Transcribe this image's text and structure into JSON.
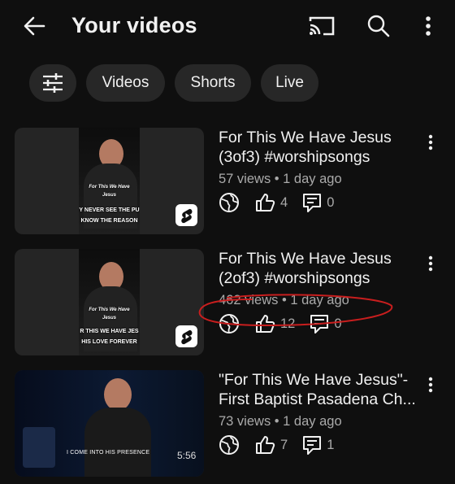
{
  "header": {
    "title": "Your videos"
  },
  "chips": [
    "Videos",
    "Shorts",
    "Live"
  ],
  "videos": [
    {
      "title_line1": "For This We Have Jesus",
      "title_line2": "(3of3) #worshipsongs",
      "views": "57 views",
      "age": "1 day ago",
      "likes": "4",
      "comments": "0",
      "caption_title_1": "For This We Have",
      "caption_title_2": "Jesus",
      "caption_line1": "Y NEVER SEE THE PU",
      "caption_line2": "KNOW THE REASON"
    },
    {
      "title_line1": "For This We Have Jesus",
      "title_line2": "(2of3) #worshipsongs",
      "views": "462 views",
      "age": "1 day ago",
      "likes": "12",
      "comments": "0",
      "caption_title_1": "For This We Have",
      "caption_title_2": "Jesus",
      "caption_line1": "R THIS WE HAVE JES",
      "caption_line2": "HIS LOVE FOREVER"
    },
    {
      "title_line1": "\"For This We Have Jesus\"-",
      "title_line2": "First Baptist Pasadena Ch...",
      "views": "73 views",
      "age": "1 day ago",
      "likes": "7",
      "comments": "1",
      "caption_line1": "I COME INTO HIS PRESENCE",
      "duration": "5:56"
    }
  ],
  "colors": {
    "background": "#0f0f0f",
    "chip": "#272727",
    "secondary_text": "#aaaaaa",
    "annotation": "#c81e1e"
  },
  "icons": [
    "back-arrow-icon",
    "cast-icon",
    "search-icon",
    "more-vert-icon",
    "filter-icon",
    "shorts-icon",
    "globe-icon",
    "thumbs-up-icon",
    "comment-icon"
  ]
}
